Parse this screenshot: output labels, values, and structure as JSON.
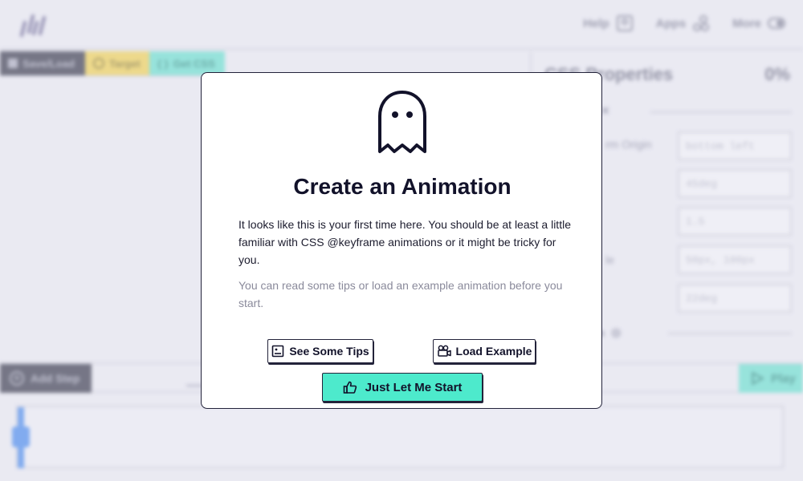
{
  "app": {
    "nav": [
      {
        "label": "Help",
        "icon": "help-icon"
      },
      {
        "label": "Apps",
        "icon": "apps-icon"
      },
      {
        "label": "More",
        "icon": "toggle-icon"
      }
    ],
    "toolbar": {
      "save_load": "Save/Load",
      "target": "Target",
      "get_css": "Get CSS"
    },
    "properties": {
      "title": "CSS Properties",
      "percent": "0%",
      "section1": "rm",
      "rows": [
        {
          "label": "rm Origin",
          "value": "bottom left"
        },
        {
          "label": "",
          "value": "45deg"
        },
        {
          "label": "",
          "value": "1.5"
        },
        {
          "label": "le",
          "value": "50px, 100px"
        },
        {
          "label": "",
          "value": "22deg"
        }
      ],
      "section2": "form"
    },
    "stepbar": {
      "add_step": "Add Step",
      "play": "Play"
    }
  },
  "modal": {
    "title": "Create an Animation",
    "text": "It looks like this is your first time here. You should be at least a little familiar with CSS @keyframe animations or it might be tricky for you.",
    "subtext": "You can read some tips or load an example animation before you start.",
    "tips_button": "See Some Tips",
    "example_button": "Load Example",
    "start_button": "Just Let Me Start",
    "accent": "#4deacc"
  }
}
